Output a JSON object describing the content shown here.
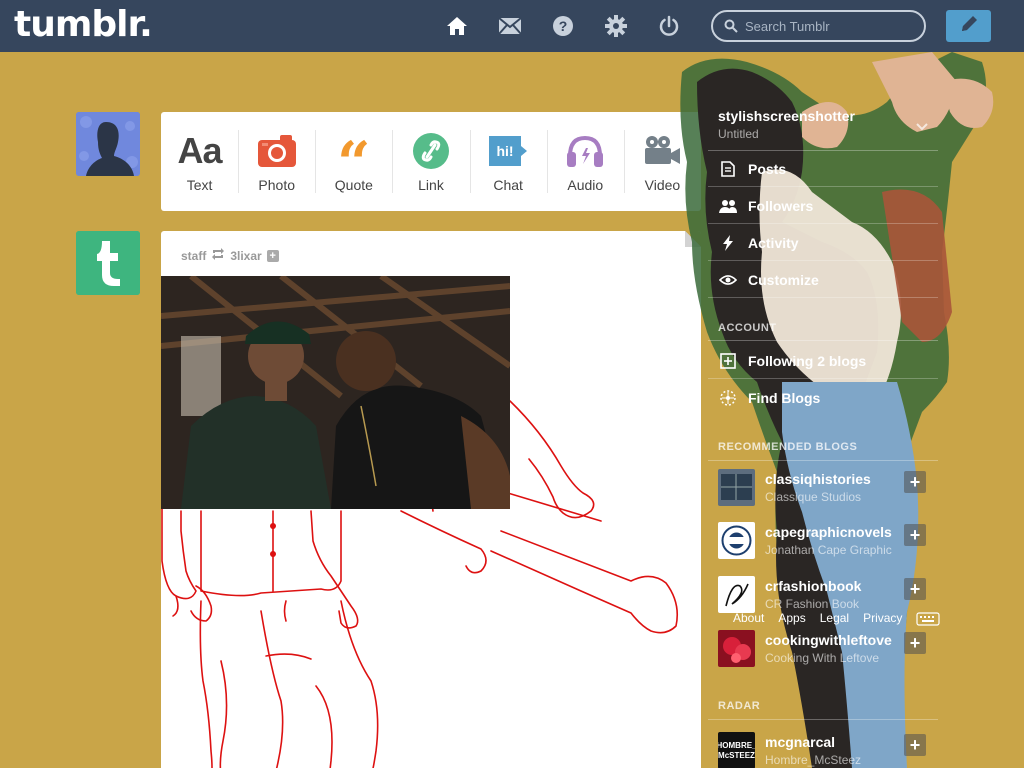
{
  "header": {
    "logo": "tumblr.",
    "search_placeholder": "Search Tumblr",
    "nav_icons": [
      "home-icon",
      "mail-icon",
      "help-icon",
      "gear-icon",
      "power-icon",
      "pencil-icon"
    ]
  },
  "post_types": [
    {
      "label": "Text",
      "icon": "text-icon"
    },
    {
      "label": "Photo",
      "icon": "camera-icon"
    },
    {
      "label": "Quote",
      "icon": "quote-icon"
    },
    {
      "label": "Link",
      "icon": "link-icon"
    },
    {
      "label": "Chat",
      "icon": "chat-icon",
      "glyph": "hi!"
    },
    {
      "label": "Audio",
      "icon": "headphones-icon"
    },
    {
      "label": "Video",
      "icon": "video-camera-icon"
    }
  ],
  "post": {
    "author": "staff",
    "reblog_from": "3lixar",
    "follow_glyph": "+"
  },
  "sidebar": {
    "blog_title": "stylishscreenshotter",
    "blog_subtitle": "Untitled",
    "blog_items": [
      {
        "label": "Posts"
      },
      {
        "label": "Followers"
      },
      {
        "label": "Activity"
      },
      {
        "label": "Customize"
      }
    ],
    "account_header": "ACCOUNT",
    "account_items": [
      {
        "label": "Following 2 blogs",
        "count": "2"
      },
      {
        "label": "Find Blogs"
      }
    ],
    "recommended_header": "RECOMMENDED BLOGS",
    "recommended": [
      {
        "name": "classiqhistories",
        "subtitle": "Classique Studios"
      },
      {
        "name": "capegraphicnovels",
        "subtitle": "Jonathan Cape Graphic"
      },
      {
        "name": "crfashionbook",
        "subtitle": "CR Fashion Book"
      },
      {
        "name": "cookingwithleftove",
        "subtitle": "Cooking With Leftove"
      }
    ],
    "footer_links": [
      "About",
      "Apps",
      "Legal",
      "Privacy"
    ],
    "radar_header": "RADAR",
    "radar": {
      "name": "mcgnarcal",
      "subtitle": "Hombre_McSteez",
      "thumb_line1": "HOMBRE_",
      "thumb_line2": "McSTEEZ"
    },
    "plus_glyph": "+"
  },
  "colors": {
    "background": "#c9a548",
    "header": "#36465d",
    "accent_blue": "#529ecc",
    "photo_red": "#e5573a",
    "quote_orange": "#f2992e",
    "link_green": "#56bc8a",
    "chat_blue": "#529ecc",
    "audio_purple": "#a77dc2",
    "video_gray": "#748089"
  }
}
